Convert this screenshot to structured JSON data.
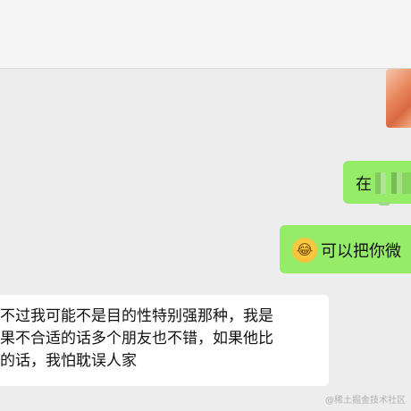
{
  "messages": {
    "outgoing_1": {
      "text": "在"
    },
    "outgoing_2": {
      "emoji": "😂",
      "text": "可以把你微"
    },
    "incoming_1": {
      "lines": [
        "不过我可能不是目的性特别强那种，我是",
        "果不合适的话多个朋友也不错，如果他比",
        "的话，我怕耽误人家"
      ]
    }
  },
  "watermark": "@稀土掘金技术社区",
  "colors": {
    "outgoing_bubble": "#95ec69",
    "incoming_bubble": "#ffffff",
    "background": "#ededed"
  }
}
